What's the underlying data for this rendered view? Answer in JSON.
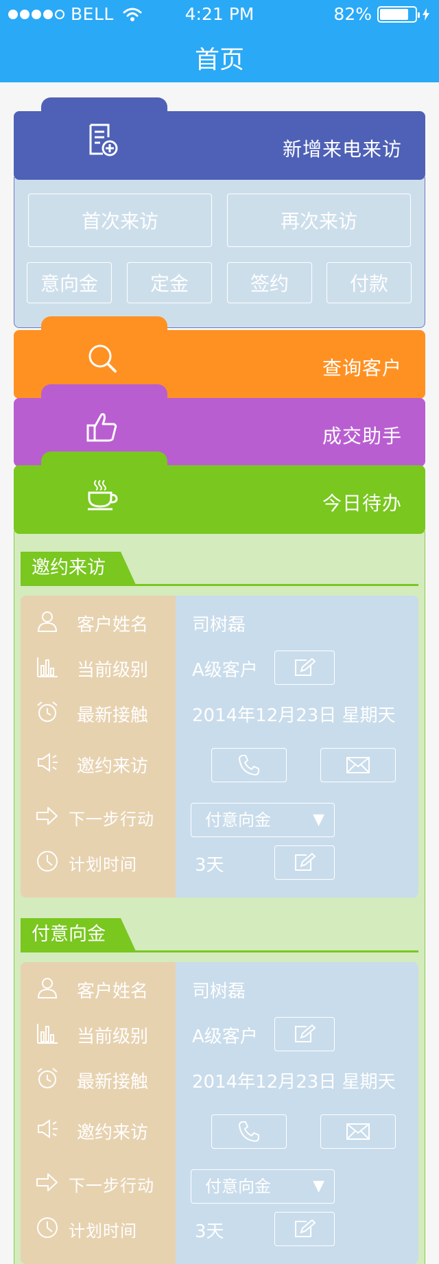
{
  "status_bar": {
    "carrier": "BELL",
    "time": "4:21 PM",
    "battery_percent": "82%",
    "battery_level": 0.82,
    "signal_dots_filled": 4,
    "signal_dots_total": 5
  },
  "header": {
    "title": "首页"
  },
  "sections": {
    "new_visit": {
      "title": "新增来电来访",
      "icon": "add-document-icon",
      "color": "#4e61b6",
      "buttons": [
        "首次来访",
        "再次来访",
        "意向金",
        "定金",
        "签约",
        "付款"
      ]
    },
    "search": {
      "title": "查询客户",
      "icon": "search-icon",
      "color": "#ff9122"
    },
    "deal": {
      "title": "成交助手",
      "icon": "thumbs-up-icon",
      "color": "#b95ed1"
    },
    "todo": {
      "title": "今日待办",
      "icon": "coffee-cup-icon",
      "color": "#79c71f"
    }
  },
  "todo_cards": [
    {
      "heading": "邀约来访",
      "labels": {
        "name": "客户姓名",
        "level": "当前级别",
        "contact": "最新接触",
        "invite": "邀约来访",
        "next": "下一步行动",
        "plan": "计划时间"
      },
      "values": {
        "name": "司树磊",
        "level": "A级客户",
        "contact": "2014年12月23日  星期天",
        "next": "付意向金",
        "plan": "3天"
      }
    },
    {
      "heading": "付意向金",
      "labels": {
        "name": "客户姓名",
        "level": "当前级别",
        "contact": "最新接触",
        "invite": "邀约来访",
        "next": "下一步行动",
        "plan": "计划时间"
      },
      "values": {
        "name": "司树磊",
        "level": "A级客户",
        "contact": "2014年12月23日  星期天",
        "next": "付意向金",
        "plan": "3天"
      }
    }
  ]
}
